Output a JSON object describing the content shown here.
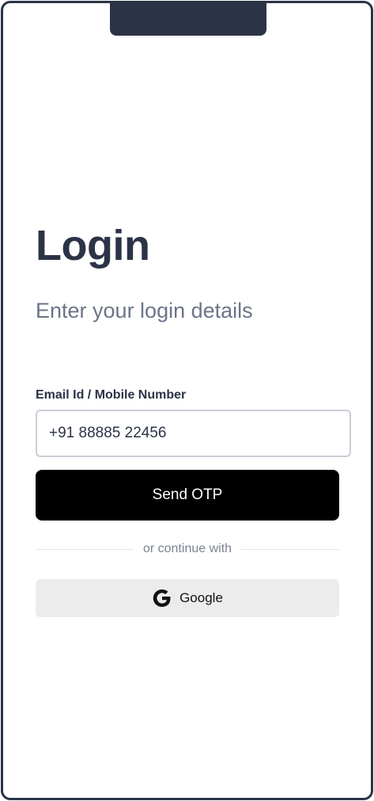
{
  "login": {
    "title": "Login",
    "subtitle": "Enter your login details",
    "field_label": "Email Id / Mobile Number",
    "input_value": "+91 88885 22456",
    "send_button_label": "Send OTP",
    "divider_text": "or continue with",
    "google_button_label": "Google",
    "google_icon": "google-g-icon"
  },
  "colors": {
    "frame": "#2b3346",
    "title": "#2b3346",
    "subtitle": "#6b7488",
    "primary_button": "#000000",
    "secondary_button": "#ececec"
  }
}
